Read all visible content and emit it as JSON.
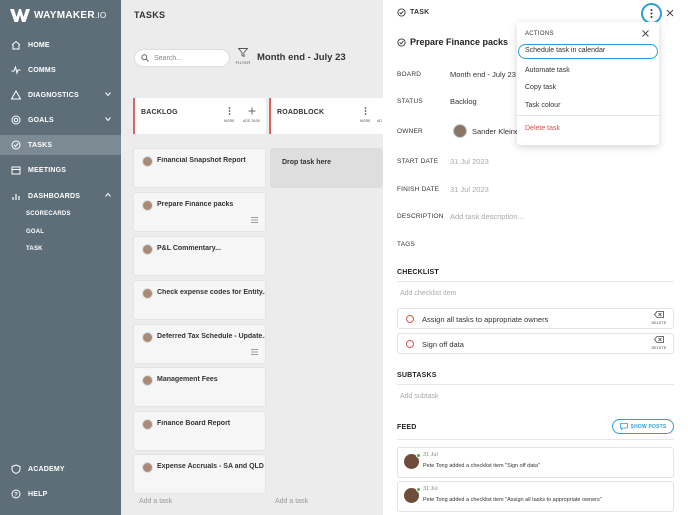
{
  "brand": {
    "name": "WAYMAKER",
    "suffix": ".IO"
  },
  "sidebar": {
    "items": [
      {
        "label": "HOME",
        "icon": "home-icon"
      },
      {
        "label": "COMMS",
        "icon": "pulse-icon"
      },
      {
        "label": "DIAGNOSTICS",
        "icon": "warning-icon"
      },
      {
        "label": "GOALS",
        "icon": "target-icon"
      },
      {
        "label": "TASKS",
        "icon": "check-circle-icon"
      },
      {
        "label": "MEETINGS",
        "icon": "calendar-icon"
      },
      {
        "label": "DASHBOARDS",
        "icon": "bar-chart-icon"
      }
    ],
    "subitems": [
      "SCORECARDS",
      "GOAL",
      "TASK"
    ],
    "footer": [
      {
        "label": "ACADEMY",
        "icon": "shield-icon"
      },
      {
        "label": "HELP",
        "icon": "help-icon"
      }
    ]
  },
  "board": {
    "title": "TASKS",
    "search_placeholder": "Search...",
    "filter_label": "FILTER",
    "period": "Month end - July 23",
    "columns": [
      {
        "name": "BACKLOG",
        "more_label": "MORE",
        "add_label": "ADD TASK"
      },
      {
        "name": "ROADBLOCK",
        "more_label": "MORE",
        "add_label": "AD"
      }
    ],
    "cards": [
      "Financial Snapshot Report",
      "Prepare Finance packs",
      "P&L Commentary...",
      "Check expense codes for Entity...",
      "Deferred Tax Schedule - Update...",
      "Management Fees",
      "Finance Board Report",
      "Expense Accruals - SA and QLD"
    ],
    "drop_text": "Drop task here",
    "add_task": "Add a task"
  },
  "panel": {
    "header": "TASK",
    "title": "Prepare Finance packs",
    "fields": {
      "board_label": "BOARD",
      "board_value": "Month end - July 23",
      "status_label": "STATUS",
      "status_value": "Backlog",
      "owner_label": "OWNER",
      "owner_value": "Sander Kleinen",
      "start_label": "START DATE",
      "start_value": "31 Jul 2023",
      "finish_label": "FINISH DATE",
      "finish_value": "31 Jul 2023",
      "desc_label": "DESCRIPTION",
      "desc_placeholder": "Add task description...",
      "tags_label": "TAGS"
    },
    "checklist": {
      "title": "CHECKLIST",
      "placeholder": "Add checklist item",
      "delete_label": "DELETE",
      "items": [
        "Assign all tasks to appropriate owners",
        "Sign off data"
      ]
    },
    "subtasks": {
      "title": "SUBTASKS",
      "placeholder": "Add subtask"
    },
    "feed": {
      "title": "FEED",
      "show_posts": "SHOW POSTS",
      "items": [
        {
          "date": "31 Jul",
          "text": "Pete Tong added a checklist item \"Sign off data\""
        },
        {
          "date": "31 Jul",
          "text": "Pete Tong added a checklist item \"Assign all tasks to appropriate owners\""
        }
      ]
    }
  },
  "menu": {
    "title": "ACTIONS",
    "items": [
      "Schedule task in calendar",
      "Automate task",
      "Copy task",
      "Task colour"
    ],
    "danger": "Delete task"
  },
  "colors": {
    "sidebar": "#5e6e78",
    "accent": "#2a9ed8",
    "danger": "#d9534f",
    "column_edge": "#e06060"
  }
}
